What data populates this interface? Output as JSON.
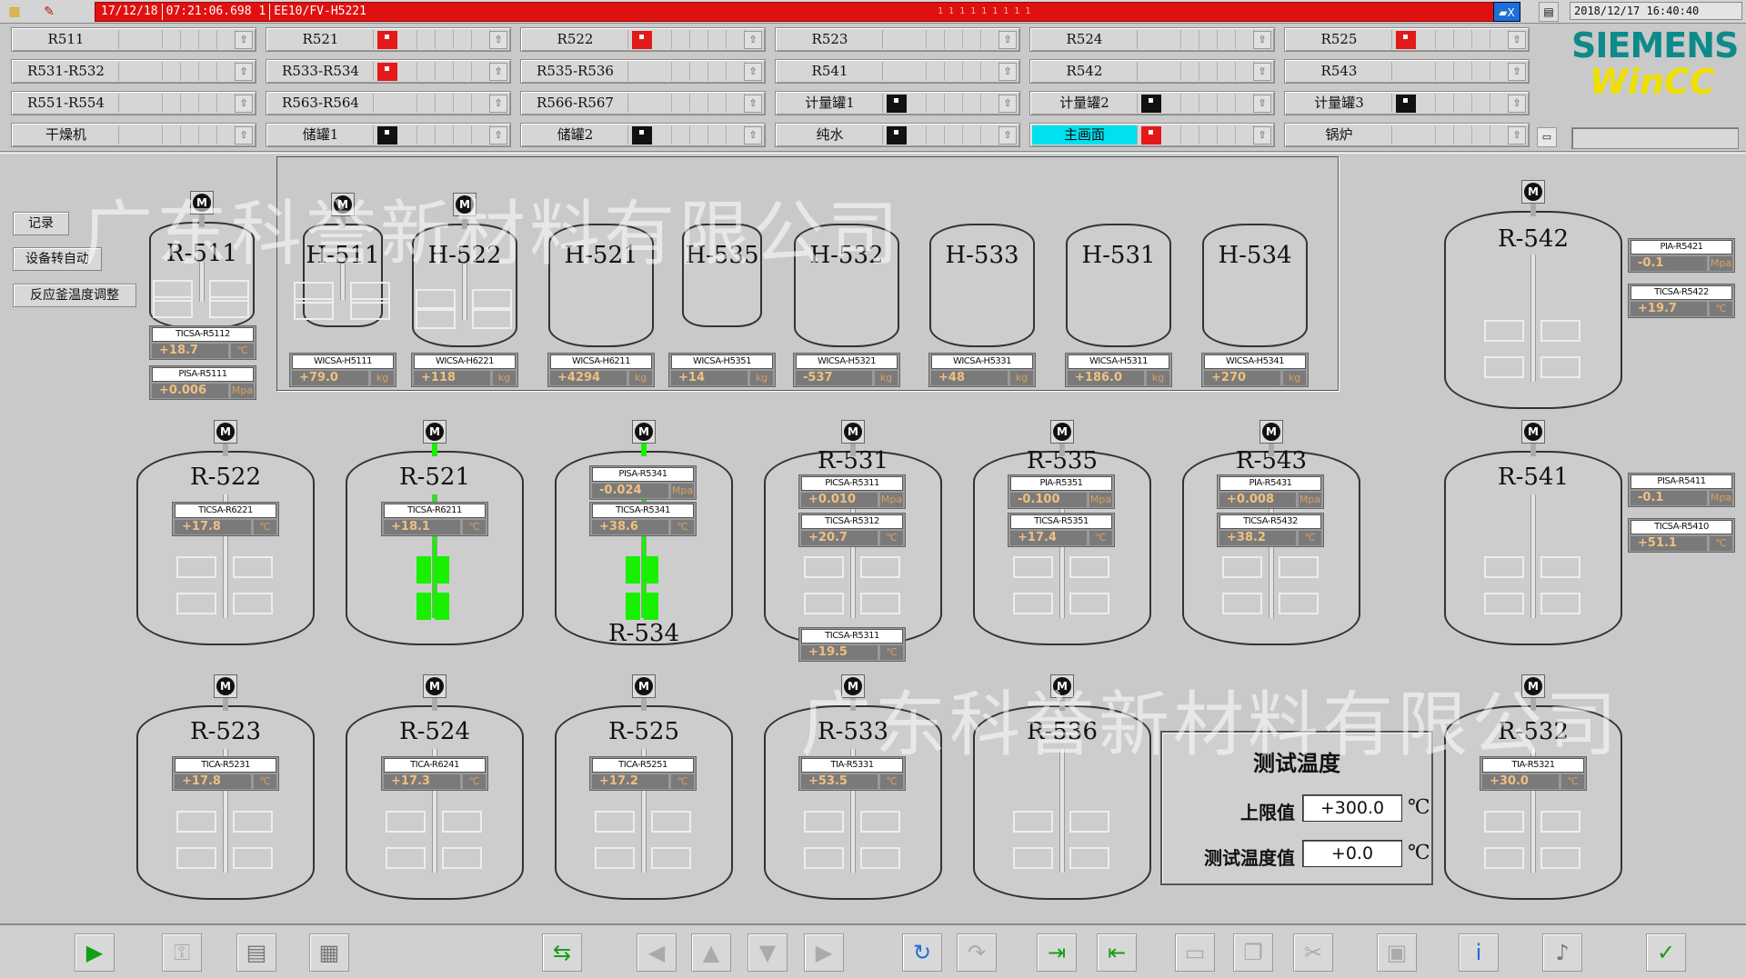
{
  "alarm": {
    "text_date": "17/12/18",
    "text_time": "07:21:06.698",
    "text_flag": "1",
    "text_tag": "EE10/FV-H5221",
    "text_right": "1 1 1 1 1 1 1 1 1"
  },
  "datetime": "2018/12/17 16:40:40",
  "logo": {
    "line1": "SIEMENS",
    "line2": "WinCC"
  },
  "nav": [
    [
      {
        "label": "R511",
        "ind": "none"
      },
      {
        "label": "R521",
        "ind": "red"
      },
      {
        "label": "R522",
        "ind": "red"
      },
      {
        "label": "R523",
        "ind": "none"
      },
      {
        "label": "R524",
        "ind": "none"
      },
      {
        "label": "R525",
        "ind": "red"
      }
    ],
    [
      {
        "label": "R531-R532",
        "ind": "none"
      },
      {
        "label": "R533-R534",
        "ind": "red"
      },
      {
        "label": "R535-R536",
        "ind": "none"
      },
      {
        "label": "R541",
        "ind": "none"
      },
      {
        "label": "R542",
        "ind": "none"
      },
      {
        "label": "R543",
        "ind": "none"
      }
    ],
    [
      {
        "label": "R551-R554",
        "ind": "none"
      },
      {
        "label": "R563-R564",
        "ind": "none"
      },
      {
        "label": "R566-R567",
        "ind": "none"
      },
      {
        "label": "计量罐1",
        "ind": "black"
      },
      {
        "label": "计量罐2",
        "ind": "black"
      },
      {
        "label": "计量罐3",
        "ind": "black"
      }
    ],
    [
      {
        "label": "干燥机",
        "ind": "none"
      },
      {
        "label": "储罐1",
        "ind": "black"
      },
      {
        "label": "储罐2",
        "ind": "black"
      },
      {
        "label": "纯水",
        "ind": "black"
      },
      {
        "label": "主画面",
        "ind": "red",
        "active": true
      },
      {
        "label": "锅炉",
        "ind": "none"
      }
    ]
  ],
  "side": [
    "记录",
    "设备转自动",
    "反应釜温度调整"
  ],
  "watermark": "广东科誉新材料有限公司",
  "vessels": {
    "R511": {
      "name": "R-511",
      "t1n": "TICSA-R5112",
      "t1v": "+18.7",
      "t1u": "℃",
      "t2n": "PISA-R5111",
      "t2v": "+0.006",
      "t2u": "Mpa"
    },
    "H511": {
      "name": "H-511",
      "tn": "WICSA-H5111",
      "tv": "+79.0",
      "tu": "kg"
    },
    "H522": {
      "name": "H-522",
      "tn": "WICSA-H6221",
      "tv": "+118",
      "tu": "kg"
    },
    "H521": {
      "name": "H-521",
      "tn": "WICSA-H6211",
      "tv": "+4294",
      "tu": "kg"
    },
    "H535": {
      "name": "H-535",
      "tn": "WICSA-H5351",
      "tv": "+14",
      "tu": "kg"
    },
    "H532": {
      "name": "H-532",
      "tn": "WICSA-H5321",
      "tv": "-537",
      "tu": "kg"
    },
    "H533": {
      "name": "H-533",
      "tn": "WICSA-H5331",
      "tv": "+48",
      "tu": "kg"
    },
    "H531": {
      "name": "H-531",
      "tn": "WICSA-H5311",
      "tv": "+186.0",
      "tu": "kg"
    },
    "H534": {
      "name": "H-534",
      "tn": "WICSA-H5341",
      "tv": "+270",
      "tu": "kg"
    },
    "R542": {
      "name": "R-542",
      "t1n": "PIA-R5421",
      "t1v": "-0.1",
      "t1u": "Mpa",
      "t2n": "TICSA-R5422",
      "t2v": "+19.7",
      "t2u": "℃"
    },
    "R522": {
      "name": "R-522",
      "t1n": "TICSA-R6221",
      "t1v": "+17.8",
      "t1u": "℃"
    },
    "R521": {
      "name": "R-521",
      "t1n": "TICSA-R6211",
      "t1v": "+18.1",
      "t1u": "℃"
    },
    "R534": {
      "name": "R-534",
      "t1n": "PISA-R5341",
      "t1v": "-0.024",
      "t1u": "Mpa",
      "t2n": "TICSA-R5341",
      "t2v": "+38.6",
      "t2u": "℃"
    },
    "R531": {
      "name": "R-531",
      "t1n": "PICSA-R5311",
      "t1v": "+0.010",
      "t1u": "Mpa",
      "t2n": "TICSA-R5312",
      "t2v": "+20.7",
      "t2u": "℃",
      "t3n": "TICSA-R5311",
      "t3v": "+19.5",
      "t3u": "℃"
    },
    "R535": {
      "name": "R-535",
      "t1n": "PIA-R5351",
      "t1v": "-0.100",
      "t1u": "Mpa",
      "t2n": "TICSA-R5351",
      "t2v": "+17.4",
      "t2u": "℃"
    },
    "R543": {
      "name": "R-543",
      "t1n": "PIA-R5431",
      "t1v": "+0.008",
      "t1u": "Mpa",
      "t2n": "TICSA-R5432",
      "t2v": "+38.2",
      "t2u": "℃"
    },
    "R541": {
      "name": "R-541",
      "t1n": "PISA-R5411",
      "t1v": "-0.1",
      "t1u": "Mpa",
      "t2n": "TICSA-R5410",
      "t2v": "+51.1",
      "t2u": "℃"
    },
    "R523": {
      "name": "R-523",
      "t1n": "TICA-R5231",
      "t1v": "+17.8",
      "t1u": "℃"
    },
    "R524": {
      "name": "R-524",
      "t1n": "TICA-R6241",
      "t1v": "+17.3",
      "t1u": "℃"
    },
    "R525": {
      "name": "R-525",
      "t1n": "TICA-R5251",
      "t1v": "+17.2",
      "t1u": "℃"
    },
    "R533": {
      "name": "R-533",
      "t1n": "TIA-R5331",
      "t1v": "+53.5",
      "t1u": "℃"
    },
    "R536": {
      "name": "R-536"
    },
    "R532": {
      "name": "R-532",
      "t1n": "TIA-R5321",
      "t1v": "+30.0",
      "t1u": "℃"
    }
  },
  "test_panel": {
    "title": "测试温度",
    "upper_label": "上限值",
    "upper_value": "+300.0",
    "value_label": "测试温度值",
    "value": "+0.0",
    "unit": "℃"
  },
  "toolbar": [
    "play-icon",
    "key-icon",
    "notes-icon",
    "report-icon",
    "transfer-icon",
    "left-arrow-icon",
    "up-arrow-icon",
    "down-arrow-icon",
    "right-arrow-icon",
    "refresh-icon",
    "redo-icon",
    "login-icon",
    "logout-icon",
    "print-icon",
    "copy-icon",
    "cut-icon",
    "monitor-icon",
    "help-icon",
    "sound-icon",
    "ack-all-icon"
  ]
}
